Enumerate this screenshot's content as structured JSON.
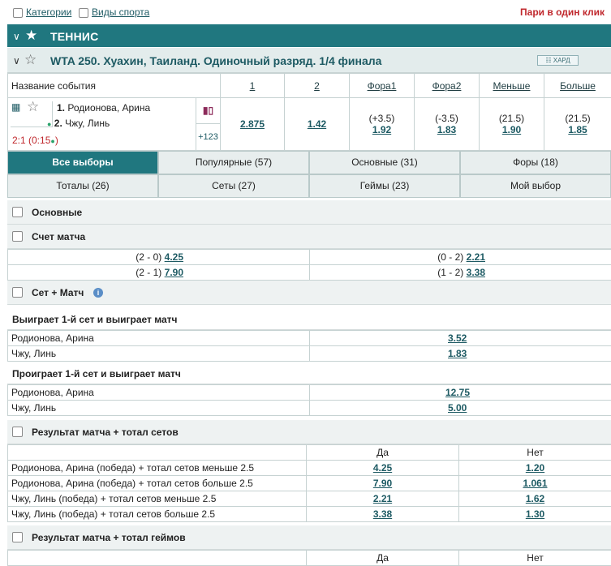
{
  "topbar": {
    "categories": "Категории",
    "sports": "Виды спорта",
    "one_click": "Пари в один клик"
  },
  "sport": {
    "title": "ТЕННИС"
  },
  "tournament": {
    "title": "WTA 250. Хуахин, Таиланд. Одиночный разряд. 1/4 финала",
    "surface": "ХАРД"
  },
  "columns": {
    "event": "Название события",
    "c1": "1",
    "c2": "2",
    "fora1": "Фора1",
    "fora2": "Фора2",
    "less": "Меньше",
    "more": "Больше"
  },
  "event": {
    "p1_num": "1.",
    "p1_name": "Родионова, Арина",
    "p2_num": "2.",
    "p2_name": "Чжу, Линь",
    "score": "2:1 (0:15",
    "score_close": ")",
    "more_markets": "+123",
    "odds1": "2.875",
    "odds2": "1.42",
    "fora1_h": "(+3.5)",
    "fora1_o": "1.92",
    "fora2_h": "(-3.5)",
    "fora2_o": "1.83",
    "less_h": "(21.5)",
    "less_o": "1.90",
    "more_h": "(21.5)",
    "more_o": "1.85"
  },
  "tabs": [
    "Все выборы",
    "Популярные (57)",
    "Основные (31)",
    "Форы (18)",
    "Тоталы (26)",
    "Сеты (27)",
    "Геймы (23)",
    "Мой выбор"
  ],
  "sections": {
    "main": "Основные",
    "score": "Счет матча",
    "score_rows": [
      {
        "l": "(2 - 0)",
        "lo": "4.25",
        "r": "(0 - 2)",
        "ro": "2.21"
      },
      {
        "l": "(2 - 1)",
        "lo": "7.90",
        "r": "(1 - 2)",
        "ro": "3.38"
      }
    ],
    "setmatch": "Сет + Матч",
    "win1": "Выиграет 1-й сет и выиграет матч",
    "win1_rows": [
      {
        "n": "Родионова, Арина",
        "o": "3.52"
      },
      {
        "n": "Чжу, Линь",
        "o": "1.83"
      }
    ],
    "lose1": "Проиграет 1-й сет и выиграет матч",
    "lose1_rows": [
      {
        "n": "Родионова, Арина",
        "o": "12.75"
      },
      {
        "n": "Чжу, Линь",
        "o": "5.00"
      }
    ],
    "result_sets": "Результат матча + тотал сетов",
    "yes": "Да",
    "no": "Нет",
    "result_sets_rows": [
      {
        "n": "Родионова, Арина (победа) + тотал сетов меньше 2.5",
        "y": "4.25",
        "x": "1.20"
      },
      {
        "n": "Родионова, Арина (победа) + тотал сетов больше 2.5",
        "y": "7.90",
        "x": "1.061"
      },
      {
        "n": "Чжу, Линь (победа) + тотал сетов меньше 2.5",
        "y": "2.21",
        "x": "1.62"
      },
      {
        "n": "Чжу, Линь (победа) + тотал сетов больше 2.5",
        "y": "3.38",
        "x": "1.30"
      }
    ],
    "result_games": "Результат матча + тотал геймов",
    "yes2": "Да",
    "no2": "Нет"
  }
}
